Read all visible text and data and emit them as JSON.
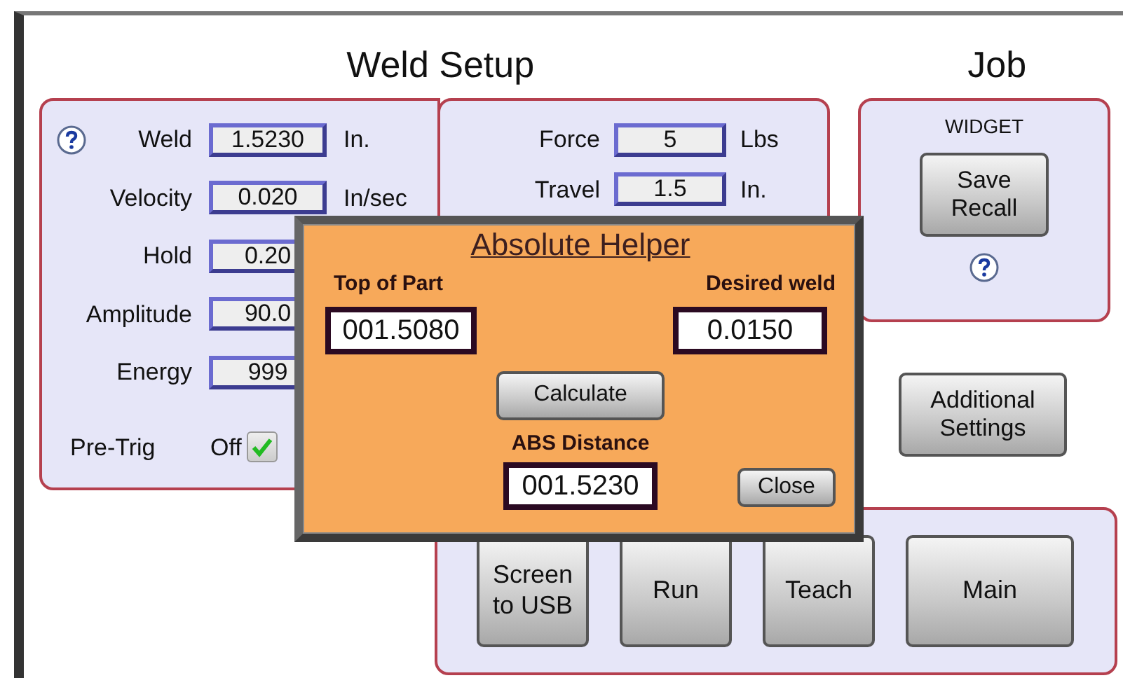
{
  "title": "Weld Setup",
  "job_title": "Job",
  "weld_params": [
    {
      "label": "Weld",
      "value": "1.5230",
      "unit": "In.",
      "help": true
    },
    {
      "label": "Velocity",
      "value": "0.020",
      "unit": "In/sec",
      "help": false
    },
    {
      "label": "Hold",
      "value": "0.20",
      "help": false
    },
    {
      "label": "Amplitude",
      "value": "90.0",
      "help": false
    },
    {
      "label": "Energy",
      "value": "999",
      "help": false
    }
  ],
  "pre_trig": {
    "label": "Pre-Trig",
    "value": "Off",
    "checked": true
  },
  "force_params": [
    {
      "label": "Force",
      "value": "5",
      "unit": "Lbs"
    },
    {
      "label": "Travel",
      "value": "1.5",
      "unit": "In."
    }
  ],
  "job": {
    "name": "WIDGET",
    "button": "Save Recall",
    "help": true
  },
  "additional_button": "Additional Settings",
  "bottom_buttons": [
    "Screen to USB",
    "Run",
    "Teach",
    "Main"
  ],
  "dialog": {
    "title": "Absolute Helper",
    "top_of_part": {
      "label": "Top of Part",
      "value": "001.5080"
    },
    "desired_weld": {
      "label": "Desired weld",
      "value": "0.0150"
    },
    "calculate": "Calculate",
    "abs_distance": {
      "label": "ABS Distance",
      "value": "001.5230"
    },
    "close": "Close"
  }
}
